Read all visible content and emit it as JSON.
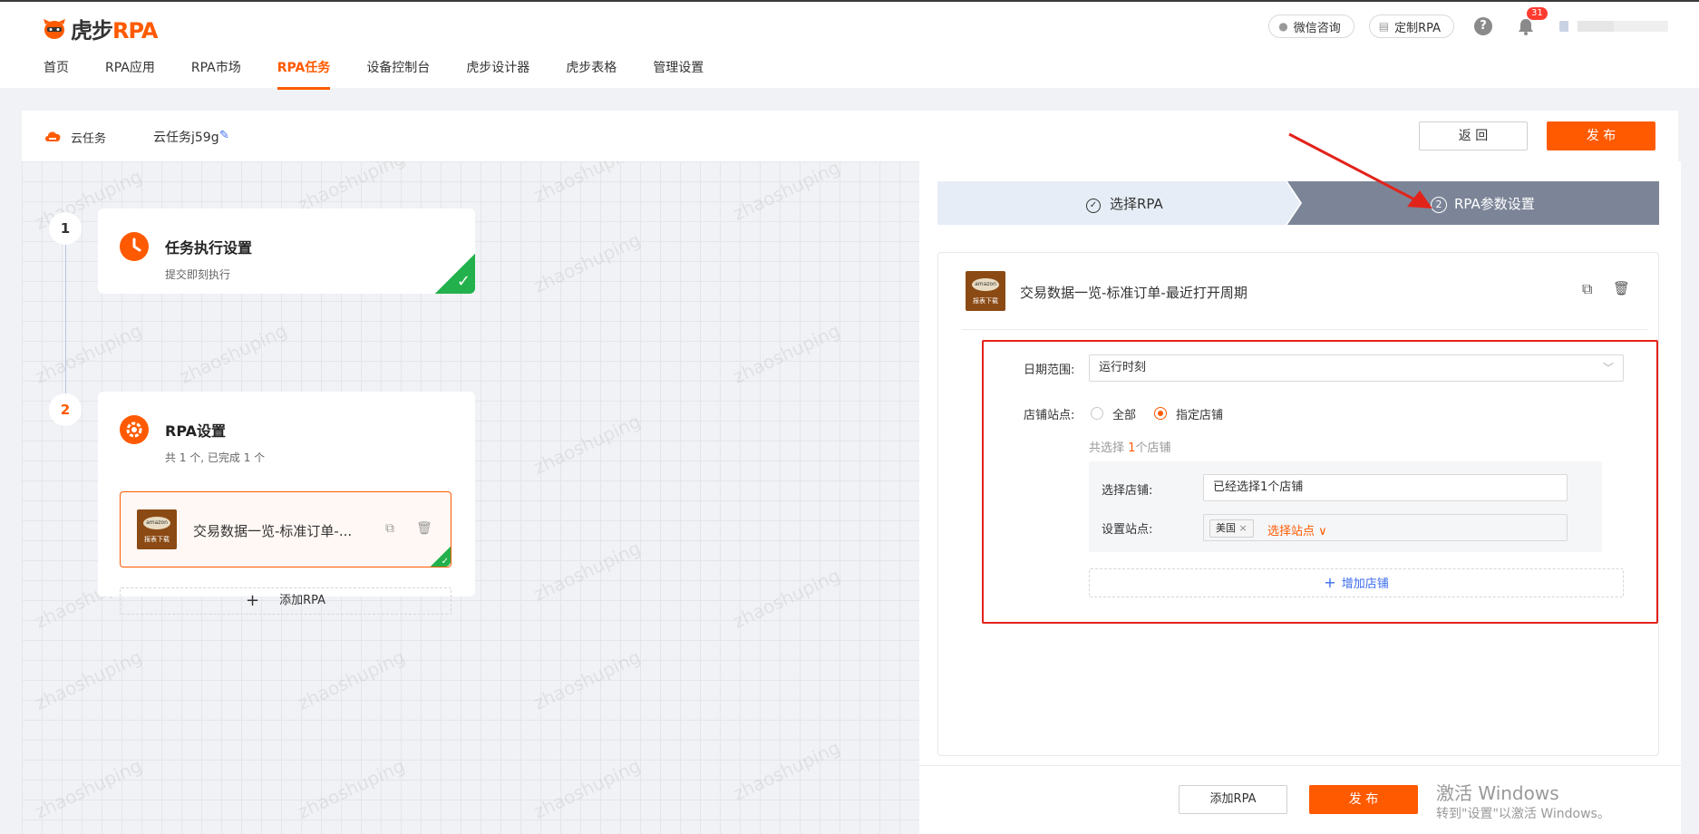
{
  "brand": {
    "name": "虎步",
    "suffix": "RPA"
  },
  "nav": [
    {
      "label": "首页"
    },
    {
      "label": "RPA应用"
    },
    {
      "label": "RPA市场"
    },
    {
      "label": "RPA任务"
    },
    {
      "label": "设备控制台"
    },
    {
      "label": "虎步设计器"
    },
    {
      "label": "虎步表格"
    },
    {
      "label": "管理设置"
    }
  ],
  "nav_active": "RPA任务",
  "top_right": {
    "wechat": "微信咨询",
    "custom": "定制RPA",
    "help": "?",
    "notifications": "31"
  },
  "subbar": {
    "type_label": "云任务",
    "task_name": "云任务j59g",
    "back": "返 回",
    "publish": "发 布"
  },
  "steps_left": [
    {
      "num": "1",
      "title": "任务执行设置",
      "sub": "提交即刻执行"
    },
    {
      "num": "2",
      "title": "RPA设置",
      "sub": "共 1 个, 已完成 1 个"
    }
  ],
  "rpa_item": {
    "name": "交易数据一览-标准订单-...",
    "logo_top": "amazon",
    "logo_bottom": "报表下载"
  },
  "add_rpa_left": "添加RPA",
  "wizard": {
    "step1": "选择RPA",
    "step2_num": "2",
    "step2": "RPA参数设置"
  },
  "form": {
    "title": "交易数据一览-标准订单-最近打开周期",
    "date_label": "日期范围:",
    "date_value": "运行时刻",
    "store_label": "店铺站点:",
    "opt_all": "全部",
    "opt_specific": "指定店铺",
    "summary_prefix": "共选择",
    "summary_count": "1",
    "summary_suffix": "个店铺",
    "choose_store_label": "选择店铺:",
    "choose_store_value": "已经选择1个店铺",
    "site_label": "设置站点:",
    "site_tag": "美国",
    "site_pick": "选择站点",
    "add_store": "增加店铺"
  },
  "footer": {
    "add_rpa": "添加RPA",
    "publish": "发 布"
  },
  "windows": {
    "line1": "激活 Windows",
    "line2": "转到\"设置\"以激活 Windows。"
  },
  "watermark": "zhaoshuping",
  "colors": {
    "accent": "#ff5a00",
    "done": "#22b14c",
    "link": "#3c6cf0"
  }
}
